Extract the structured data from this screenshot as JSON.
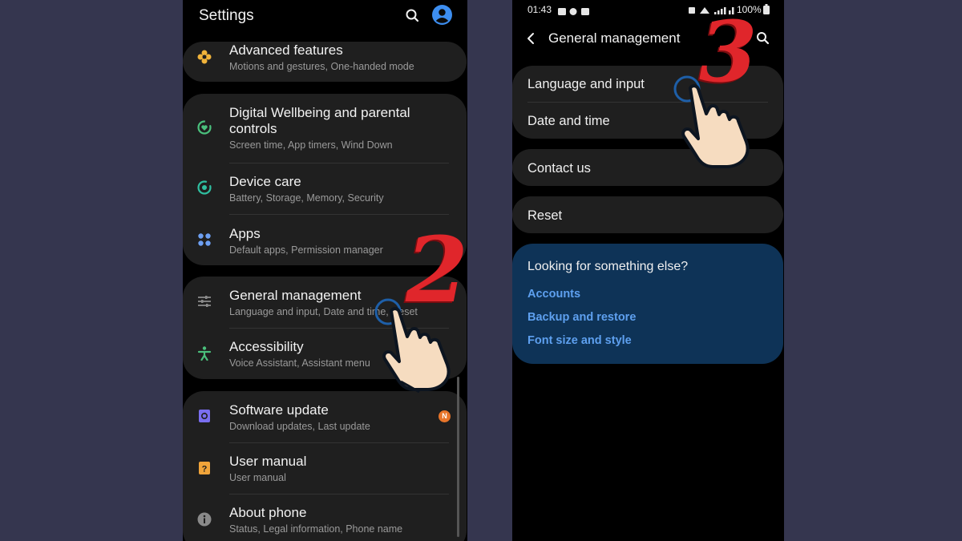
{
  "left": {
    "header": {
      "title": "Settings"
    },
    "items": [
      {
        "title": "Advanced features",
        "sub": "Motions and gestures, One-handed mode"
      },
      {
        "title": "Digital Wellbeing and parental controls",
        "sub": "Screen time, App timers, Wind Down"
      },
      {
        "title": "Device care",
        "sub": "Battery, Storage, Memory, Security"
      },
      {
        "title": "Apps",
        "sub": "Default apps, Permission manager"
      },
      {
        "title": "General management",
        "sub": "Language and input, Date and time, Reset"
      },
      {
        "title": "Accessibility",
        "sub": "Voice Assistant, Assistant menu"
      },
      {
        "title": "Software update",
        "sub": "Download updates, Last update"
      },
      {
        "title": "User manual",
        "sub": "User manual"
      },
      {
        "title": "About phone",
        "sub": "Status, Legal information, Phone name"
      }
    ],
    "badge": "N",
    "step_number": "2"
  },
  "right": {
    "status": {
      "time": "01:43",
      "battery": "100%"
    },
    "header": {
      "title": "General management"
    },
    "items": [
      {
        "title": "Language and input"
      },
      {
        "title": "Date and time"
      },
      {
        "title": "Contact us"
      },
      {
        "title": "Reset"
      }
    ],
    "suggest": {
      "title": "Looking for something else?",
      "links": [
        "Accounts",
        "Backup and restore",
        "Font size and style"
      ]
    },
    "step_number": "3"
  },
  "colors": {
    "background": "#35364f",
    "card": "#1f1f1f",
    "link": "#5ea0ef",
    "suggest_card": "#0e3357",
    "annotation_red": "#e0262b"
  }
}
